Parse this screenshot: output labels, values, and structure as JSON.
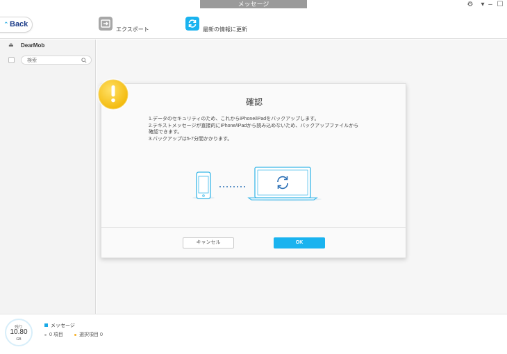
{
  "window": {
    "title": "メッセージ"
  },
  "toolbar": {
    "back_label": "Back",
    "export_label": "エクスポート",
    "refresh_label": "最新の情報に更新"
  },
  "sidebar": {
    "device_name": "DearMob",
    "search_placeholder": "検索"
  },
  "dialog": {
    "title": "確認",
    "lines": [
      "1.データのセキュリティのため、これからiPhone/iPadをバックアップします。",
      "2.テキストメッセージが直接的にiPhone/iPadから読み込めないため、バックアップファイルから",
      "確認できます。",
      "3.バックアップは5-7分間かかります。"
    ],
    "cancel_label": "キャンセル",
    "ok_label": "OK"
  },
  "footer": {
    "storage_label": "残り",
    "storage_value": "10.80",
    "storage_unit": "GB",
    "category_label": "メッセージ",
    "items_count": "0 項目",
    "selected_count": "選択項目 0"
  },
  "colors": {
    "accent": "#1ab3ef",
    "warning": "#f6c81a",
    "brand_text": "#1f3f8a"
  }
}
